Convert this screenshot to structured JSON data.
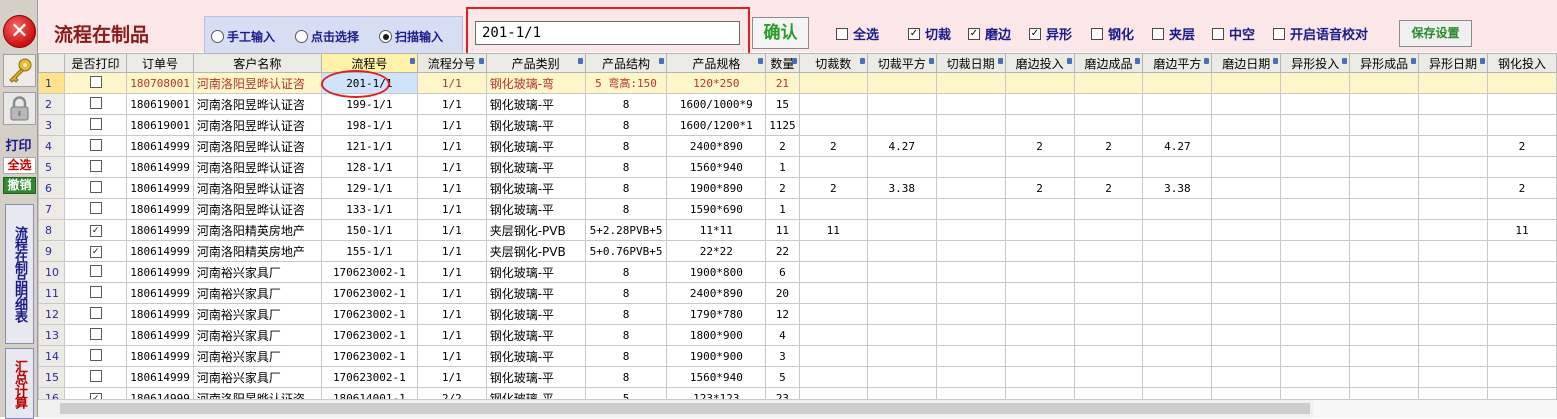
{
  "sidebar": {
    "close_symbol": "✕",
    "key_icon": "key-icon",
    "lock_icon": "lock-icon",
    "print_label": "打印",
    "select_all_label": "全选",
    "cancel_label": "撤销",
    "detail_label": "流程在制品明细表",
    "summary_label": "汇总计算"
  },
  "toolbar": {
    "title": "流程在制品",
    "modes": [
      {
        "label": "手工输入",
        "selected": false
      },
      {
        "label": "点击选择",
        "selected": false
      },
      {
        "label": "扫描输入",
        "selected": true
      }
    ],
    "scan_value": "201-1/1",
    "confirm_label": "确认",
    "checkboxes": [
      {
        "label": "全选",
        "checked": false
      },
      {
        "label": "切裁",
        "checked": true
      },
      {
        "label": "磨边",
        "checked": true
      },
      {
        "label": "异形",
        "checked": true
      },
      {
        "label": "钢化",
        "checked": false
      },
      {
        "label": "夹层",
        "checked": false
      },
      {
        "label": "中空",
        "checked": false
      },
      {
        "label": "开启语音校对",
        "checked": false
      }
    ],
    "save_label": "保存设置"
  },
  "grid": {
    "columns": [
      "是否打印",
      "订单号",
      "客户名称",
      "流程号",
      "流程分号",
      "产品类别",
      "产品结构",
      "产品规格",
      "数量",
      "切裁数",
      "切裁平方",
      "切裁日期",
      "磨边投入",
      "磨边成品",
      "磨边平方",
      "磨边日期",
      "异形投入",
      "异形成品",
      "异形日期",
      "钢化投入"
    ],
    "rows": [
      [
        "1",
        "",
        "180708001",
        "河南洛阳昱晔认证咨",
        "201-1/1",
        "1/1",
        "钢化玻璃-弯",
        "5 弯高:150",
        "120*250",
        "21",
        "",
        "",
        "",
        "",
        "",
        "",
        "",
        "",
        "",
        "",
        ""
      ],
      [
        "2",
        "",
        "180619001",
        "河南洛阳昱晔认证咨",
        "199-1/1",
        "1/1",
        "钢化玻璃-平",
        "8",
        "1600/1000*9",
        "15",
        "",
        "",
        "",
        "",
        "",
        "",
        "",
        "",
        "",
        "",
        ""
      ],
      [
        "3",
        "",
        "180619001",
        "河南洛阳昱晔认证咨",
        "198-1/1",
        "1/1",
        "钢化玻璃-平",
        "8",
        "1600/1200*1",
        "1125",
        "",
        "",
        "",
        "",
        "",
        "",
        "",
        "",
        "",
        "",
        ""
      ],
      [
        "4",
        "",
        "180614999",
        "河南洛阳昱晔认证咨",
        "121-1/1",
        "1/1",
        "钢化玻璃-平",
        "8",
        "2400*890",
        "2",
        "2",
        "4.27",
        "",
        "2",
        "2",
        "4.27",
        "",
        "",
        "",
        "",
        "2"
      ],
      [
        "5",
        "",
        "180614999",
        "河南洛阳昱晔认证咨",
        "128-1/1",
        "1/1",
        "钢化玻璃-平",
        "8",
        "1560*940",
        "1",
        "",
        "",
        "",
        "",
        "",
        "",
        "",
        "",
        "",
        "",
        ""
      ],
      [
        "6",
        "",
        "180614999",
        "河南洛阳昱晔认证咨",
        "129-1/1",
        "1/1",
        "钢化玻璃-平",
        "8",
        "1900*890",
        "2",
        "2",
        "3.38",
        "",
        "2",
        "2",
        "3.38",
        "",
        "",
        "",
        "",
        "2"
      ],
      [
        "7",
        "",
        "180614999",
        "河南洛阳昱晔认证咨",
        "133-1/1",
        "1/1",
        "钢化玻璃-平",
        "8",
        "1590*690",
        "1",
        "",
        "",
        "",
        "",
        "",
        "",
        "",
        "",
        "",
        "",
        ""
      ],
      [
        "8",
        "✓",
        "180614999",
        "河南洛阳精英房地产",
        "150-1/1",
        "1/1",
        "夹层钢化-PVB",
        "5+2.28PVB+5",
        "11*11",
        "11",
        "11",
        "",
        "",
        "",
        "",
        "",
        "",
        "",
        "",
        "",
        "11"
      ],
      [
        "9",
        "✓",
        "180614999",
        "河南洛阳精英房地产",
        "155-1/1",
        "1/1",
        "夹层钢化-PVB",
        "5+0.76PVB+5",
        "22*22",
        "22",
        "",
        "",
        "",
        "",
        "",
        "",
        "",
        "",
        "",
        "",
        ""
      ],
      [
        "10",
        "",
        "180614999",
        "河南裕兴家具厂",
        "170623002-1",
        "1/1",
        "钢化玻璃-平",
        "8",
        "1900*800",
        "6",
        "",
        "",
        "",
        "",
        "",
        "",
        "",
        "",
        "",
        "",
        ""
      ],
      [
        "11",
        "",
        "180614999",
        "河南裕兴家具厂",
        "170623002-1",
        "1/1",
        "钢化玻璃-平",
        "8",
        "2400*890",
        "20",
        "",
        "",
        "",
        "",
        "",
        "",
        "",
        "",
        "",
        "",
        ""
      ],
      [
        "12",
        "",
        "180614999",
        "河南裕兴家具厂",
        "170623002-1",
        "1/1",
        "钢化玻璃-平",
        "8",
        "1790*780",
        "12",
        "",
        "",
        "",
        "",
        "",
        "",
        "",
        "",
        "",
        "",
        ""
      ],
      [
        "13",
        "",
        "180614999",
        "河南裕兴家具厂",
        "170623002-1",
        "1/1",
        "钢化玻璃-平",
        "8",
        "1800*900",
        "4",
        "",
        "",
        "",
        "",
        "",
        "",
        "",
        "",
        "",
        "",
        ""
      ],
      [
        "14",
        "",
        "180614999",
        "河南裕兴家具厂",
        "170623002-1",
        "1/1",
        "钢化玻璃-平",
        "8",
        "1900*900",
        "3",
        "",
        "",
        "",
        "",
        "",
        "",
        "",
        "",
        "",
        "",
        ""
      ],
      [
        "15",
        "",
        "180614999",
        "河南裕兴家具厂",
        "170623002-1",
        "1/1",
        "钢化玻璃-平",
        "8",
        "1560*940",
        "5",
        "",
        "",
        "",
        "",
        "",
        "",
        "",
        "",
        "",
        "",
        ""
      ],
      [
        "16",
        "✓",
        "180614999",
        "河南洛阳昱晔认证咨",
        "180614001-1",
        "2/2",
        "钢化玻璃-平",
        "5",
        "123*123",
        "23",
        "",
        "",
        "",
        "",
        "",
        "",
        "",
        "",
        "",
        "",
        ""
      ]
    ]
  }
}
